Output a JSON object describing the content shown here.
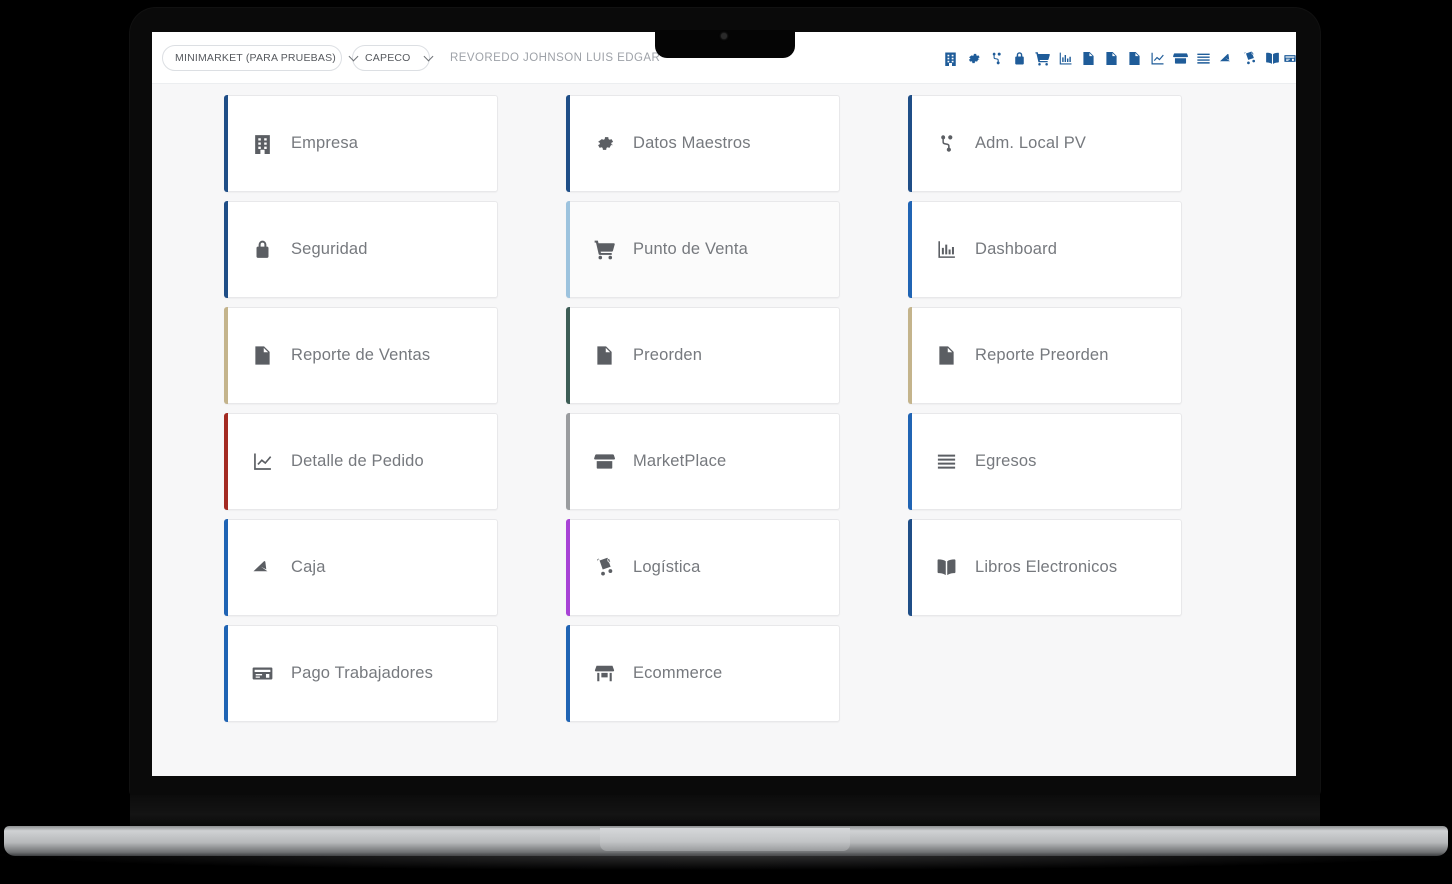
{
  "header": {
    "company_select": {
      "value": "MINIMARKET (PARA PRUEBAS)",
      "caret": "chevron-down-icon"
    },
    "branch_select": {
      "value": "CAPECO",
      "caret": "chevron-down-icon"
    },
    "user_name": "REVOREDO JOHNSON LUIS EDGAR",
    "toolbar_icons": [
      {
        "name": "building-icon",
        "title": "Empresa"
      },
      {
        "name": "gear-icon",
        "title": "Datos Maestros"
      },
      {
        "name": "sitemap-icon",
        "title": "Adm. Local PV"
      },
      {
        "name": "lock-icon",
        "title": "Seguridad"
      },
      {
        "name": "shopping-cart-icon",
        "title": "Punto de Venta"
      },
      {
        "name": "bar-chart-icon",
        "title": "Dashboard"
      },
      {
        "name": "excel-file-icon",
        "title": "Reporte de Ventas"
      },
      {
        "name": "excel-file-icon",
        "title": "Preorden"
      },
      {
        "name": "excel-file-icon",
        "title": "Reporte Preorden"
      },
      {
        "name": "line-chart-icon",
        "title": "Detalle de Pedido"
      },
      {
        "name": "store-icon",
        "title": "MarketPlace"
      },
      {
        "name": "list-icon",
        "title": "Egresos"
      },
      {
        "name": "cash-register-icon",
        "title": "Caja"
      },
      {
        "name": "dolly-icon",
        "title": "Logistica"
      },
      {
        "name": "book-icon",
        "title": "Libros Electronicos"
      },
      {
        "name": "credit-card-icon",
        "title": "Pago Trabajadores"
      }
    ]
  },
  "columns": [
    {
      "cards": [
        {
          "label": "Empresa",
          "icon": "building-icon",
          "accent": "#1f4e87",
          "tinted": false
        },
        {
          "label": "Seguridad",
          "icon": "lock-icon",
          "accent": "#1f4e87",
          "tinted": false
        },
        {
          "label": "Reporte de Ventas",
          "icon": "excel-file-icon",
          "accent": "#c4b48c",
          "tinted": false
        },
        {
          "label": "Detalle de Pedido",
          "icon": "line-chart-icon",
          "accent": "#a32a22",
          "tinted": false
        },
        {
          "label": "Caja",
          "icon": "cash-register-icon",
          "accent": "#2064b4",
          "tinted": false
        },
        {
          "label": "Pago Trabajadores",
          "icon": "credit-card-icon",
          "accent": "#2064b4",
          "tinted": false
        }
      ]
    },
    {
      "cards": [
        {
          "label": "Datos Maestros",
          "icon": "gear-icon",
          "accent": "#1f4e87",
          "tinted": false
        },
        {
          "label": "Punto de Venta",
          "icon": "shopping-cart-icon",
          "accent": "#9dc3de",
          "tinted": true
        },
        {
          "label": "Preorden",
          "icon": "excel-file-icon",
          "accent": "#3d5d56",
          "tinted": false
        },
        {
          "label": "MarketPlace",
          "icon": "store-icon",
          "accent": "#9a9c9f",
          "tinted": false
        },
        {
          "label": "Logística",
          "icon": "dolly-icon",
          "accent": "#a843d6",
          "tinted": false
        },
        {
          "label": "Ecommerce",
          "icon": "store-front-icon",
          "accent": "#2064b4",
          "tinted": false
        }
      ]
    },
    {
      "cards": [
        {
          "label": "Adm. Local PV",
          "icon": "sitemap-icon",
          "accent": "#1f4e87",
          "tinted": false
        },
        {
          "label": "Dashboard",
          "icon": "bar-chart-icon",
          "accent": "#2064b4",
          "tinted": false
        },
        {
          "label": "Reporte Preorden",
          "icon": "excel-file-icon",
          "accent": "#c4b48c",
          "tinted": false
        },
        {
          "label": "Egresos",
          "icon": "list-icon",
          "accent": "#2064b4",
          "tinted": false
        },
        {
          "label": "Libros Electronicos",
          "icon": "book-icon",
          "accent": "#1f4e87",
          "tinted": false
        }
      ]
    }
  ]
}
